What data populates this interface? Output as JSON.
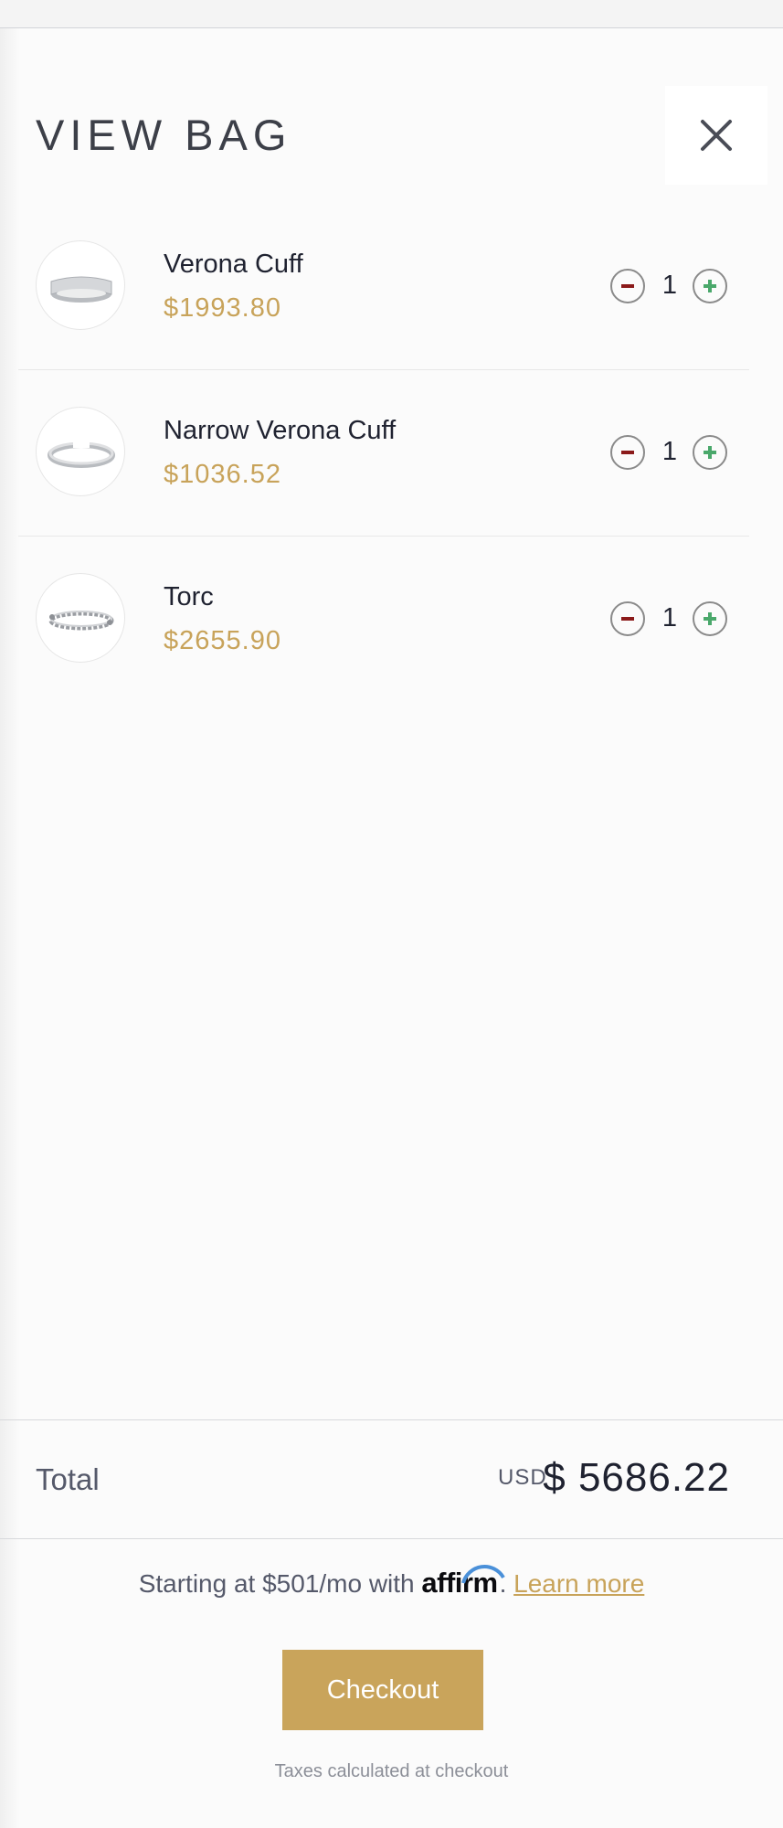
{
  "header": {
    "title": "VIEW BAG"
  },
  "items": [
    {
      "name": "Verona Cuff",
      "price": "$1993.80",
      "quantity": "1",
      "image": "silver-wide-cuff-bracelet"
    },
    {
      "name": "Narrow Verona Cuff",
      "price": "$1036.52",
      "quantity": "1",
      "image": "silver-narrow-cuff-bracelet"
    },
    {
      "name": "Torc",
      "price": "$2655.90",
      "quantity": "1",
      "image": "silver-twisted-torc-bracelet"
    }
  ],
  "summary": {
    "total_label": "Total",
    "currency": "USD",
    "total_amount": "$ 5686.22"
  },
  "financing": {
    "prefix": "Starting at $501/mo with",
    "brand": "affirm",
    "suffix": ".",
    "link": "Learn more"
  },
  "actions": {
    "checkout_label": "Checkout",
    "tax_note": "Taxes calculated at checkout"
  },
  "colors": {
    "accent_gold": "#c9a45b",
    "price_gold": "#c8a35a",
    "minus_red": "#8b1a1a",
    "plus_green": "#4aa86b",
    "affirm_blue": "#4a90d9"
  },
  "icons": {
    "close": "close-icon",
    "decrease": "minus-icon",
    "increase": "plus-icon"
  }
}
